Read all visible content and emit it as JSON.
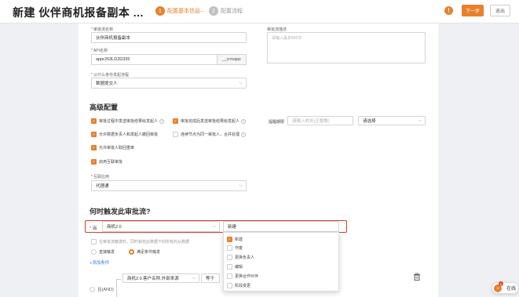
{
  "header": {
    "title": "新建 伙伴商机报备副本 ...",
    "steps": [
      {
        "num": "1",
        "label": "配置基本信息"
      },
      {
        "num": "2",
        "label": "配置流程"
      }
    ],
    "next_label": "下一步",
    "exit_label": "退出",
    "help_glyph": "!"
  },
  "basic": {
    "name_label": "审批流名称",
    "name_value": "伙伴商机报备副本",
    "desc_label": "审批流描述",
    "desc_placeholder": "请输入最多500字",
    "api_label": "API名称",
    "api_value": "appr263LD2D335",
    "api_suffix": "__crmappr",
    "initiator_label": "以什么身份发起流程",
    "initiator_value": "数据提交人"
  },
  "advanced": {
    "title": "高级配置",
    "options": [
      {
        "label": "审批过程中发送审批结果给发起人",
        "checked": true
      },
      {
        "label": "审批完成后发送审批结果给发起人",
        "checked": true
      },
      {
        "label": "允许数据负责人和发起人撤回审批",
        "checked": true
      },
      {
        "label": "连续节点为同一审批人，合并处理",
        "checked": false
      },
      {
        "label": "允许审批人取回重审",
        "checked": true
      },
      {
        "label": "启用互联审批",
        "checked": true
      }
    ],
    "timeout_label": "提醒期限",
    "timeout_placeholder": "请输入时长(正整数)",
    "timeout_select": "请选择",
    "app_label": "互联应用",
    "app_value": "代理通"
  },
  "trigger": {
    "title": "何时触发此审批流?",
    "when_label": "当",
    "object_value": "商机2.0",
    "event_value": "新建",
    "events": [
      {
        "label": "新建",
        "checked": true
      },
      {
        "label": "作废",
        "checked": false
      },
      {
        "label": "更换负责人",
        "checked": false
      },
      {
        "label": "编辑",
        "checked": false
      },
      {
        "label": "更换合作伙伴",
        "checked": false
      },
      {
        "label": "阶段变更",
        "checked": false
      }
    ],
    "lock_option": "在审批流触发时，同时锁定此数据下的所有的从数据",
    "radio_direct": "直接触发",
    "radio_condition": "满足条件触发",
    "add_condition": "+添加条件",
    "logic_label": "且(AND)",
    "field_value": "商机2.0.客户名称.外部来源",
    "operator_value": "等于"
  },
  "float": {
    "online_label": "在线",
    "badge": "6"
  },
  "colors": {
    "accent": "#e8802c",
    "highlight": "#d93a2b"
  }
}
